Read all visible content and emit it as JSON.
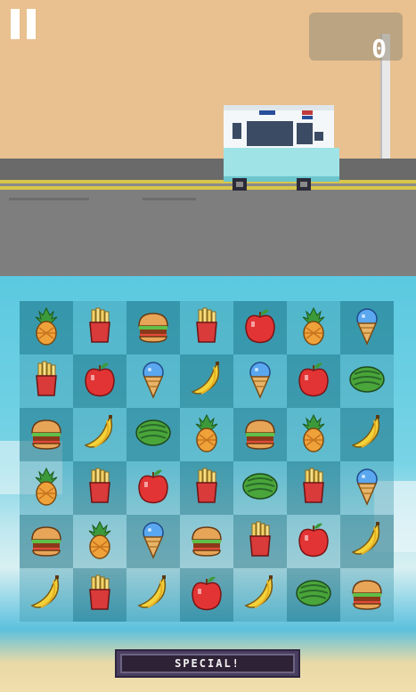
{
  "hud": {
    "score": "0",
    "pause_icon": "pause-icon"
  },
  "special_button": {
    "label": "SPECIAL!"
  },
  "board": {
    "rows": [
      [
        "pineapple",
        "fries",
        "burger",
        "fries",
        "apple",
        "pineapple",
        "icecream"
      ],
      [
        "fries",
        "apple",
        "icecream",
        "banana",
        "icecream",
        "apple",
        "watermelon"
      ],
      [
        "burger",
        "banana",
        "watermelon",
        "pineapple",
        "burger",
        "pineapple",
        "banana"
      ],
      [
        "pineapple",
        "fries",
        "apple",
        "fries",
        "watermelon",
        "fries",
        "icecream"
      ],
      [
        "burger",
        "pineapple",
        "icecream",
        "burger",
        "fries",
        "apple",
        "banana"
      ],
      [
        "banana",
        "fries",
        "banana",
        "apple",
        "banana",
        "watermelon",
        "burger"
      ]
    ]
  },
  "colors": {
    "sky": "#e9c08f",
    "road": "#7e7e7e",
    "road_stripe": "#d7c64a",
    "sea": "#5bc9e0",
    "cell_dark": "#146e82",
    "button_bg": "#2e2236"
  }
}
